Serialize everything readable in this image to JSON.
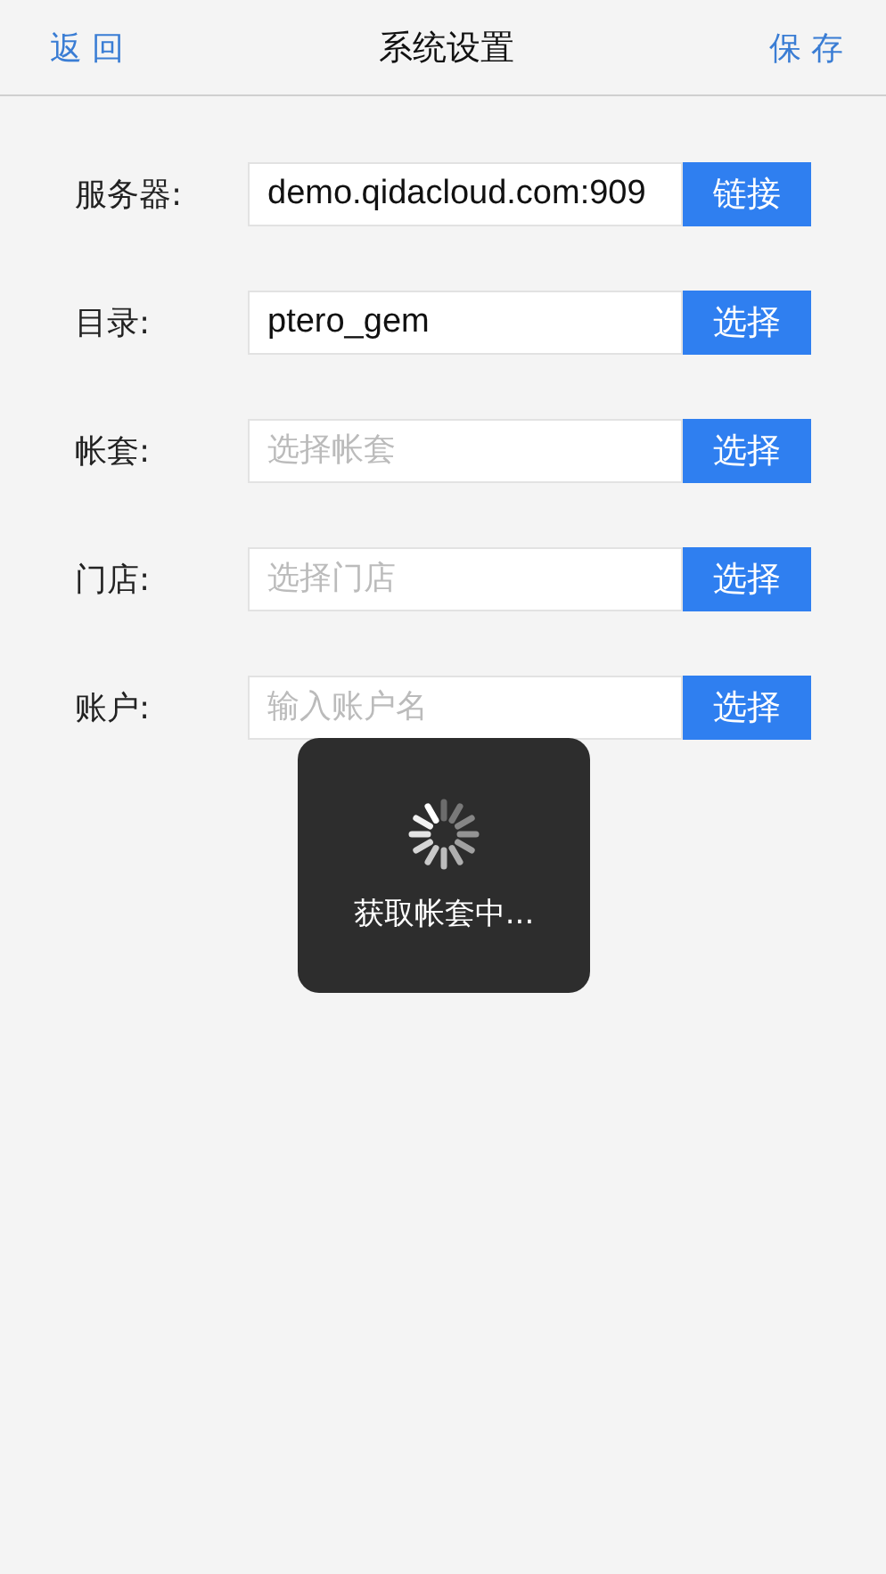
{
  "nav_bar": {
    "back": "返 回",
    "title": "系统设置",
    "save": "保 存"
  },
  "fields": [
    {
      "label": "服务器:",
      "value": "demo.qidacloud.com:909",
      "button": "链接"
    },
    {
      "label": "目录:",
      "value": "ptero_gem",
      "button": "选择"
    },
    {
      "label": "帐套:",
      "placeholder": "选择帐套",
      "button": "选择"
    },
    {
      "label": "门店:",
      "placeholder": "选择门店",
      "button": "选择"
    },
    {
      "label": "账户:",
      "placeholder": "输入账户名",
      "button": "选择"
    }
  ],
  "toast": {
    "text": "获取帐套中..."
  }
}
